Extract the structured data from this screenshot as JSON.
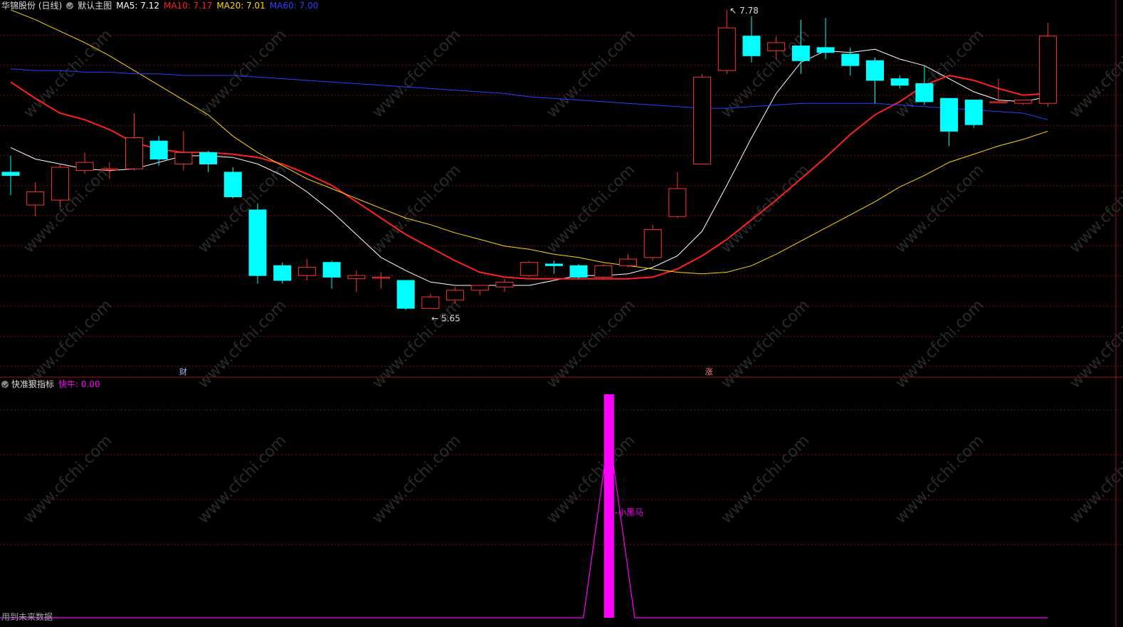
{
  "header": {
    "stock_title": "华锦股份 (日线)",
    "main_chart_label": "默认主图",
    "ma_items": [
      {
        "label": "MA5: 7.12",
        "color": "#ffffff"
      },
      {
        "label": "MA10: 7.17",
        "color": "#ff2020"
      },
      {
        "label": "MA20: 7.01",
        "color": "#ffd700"
      },
      {
        "label": "MA60: 7.00",
        "color": "#2e3dff"
      }
    ]
  },
  "indicator_panel": {
    "title": "快准狠指标",
    "value_label": "快牛: 0.00",
    "value_color": "#ff00ff",
    "signal_label": "小黑马"
  },
  "annotations": {
    "high_label": "7.78",
    "low_label": "5.65",
    "event_cai": "财",
    "event_zhang": "涨"
  },
  "footer": {
    "note": "用到未来数据"
  },
  "watermark": "www.cfchi.com",
  "colors": {
    "up": "#ff3333",
    "down": "#00ffff",
    "grid": "#7a1010"
  },
  "chart_data": {
    "type": "candlestick",
    "price_range": [
      5.55,
      7.85
    ],
    "candles": [
      {
        "o": 6.8,
        "c": 6.78,
        "h": 6.9,
        "l": 6.66
      },
      {
        "o": 6.6,
        "c": 6.68,
        "h": 6.74,
        "l": 6.53
      },
      {
        "o": 6.63,
        "c": 6.83,
        "h": 6.85,
        "l": 6.59
      },
      {
        "o": 6.81,
        "c": 6.86,
        "h": 6.92,
        "l": 6.79
      },
      {
        "o": 6.82,
        "c": 6.82,
        "h": 6.86,
        "l": 6.76
      },
      {
        "o": 6.82,
        "c": 7.01,
        "h": 7.16,
        "l": 6.81
      },
      {
        "o": 6.99,
        "c": 6.88,
        "h": 7.02,
        "l": 6.84
      },
      {
        "o": 6.85,
        "c": 6.92,
        "h": 7.05,
        "l": 6.81
      },
      {
        "o": 6.92,
        "c": 6.85,
        "h": 6.93,
        "l": 6.8
      },
      {
        "o": 6.8,
        "c": 6.65,
        "h": 6.83,
        "l": 6.64
      },
      {
        "o": 6.57,
        "c": 6.17,
        "h": 6.61,
        "l": 6.12
      },
      {
        "o": 6.23,
        "c": 6.14,
        "h": 6.25,
        "l": 6.12
      },
      {
        "o": 6.17,
        "c": 6.22,
        "h": 6.27,
        "l": 6.14
      },
      {
        "o": 6.25,
        "c": 6.16,
        "h": 6.26,
        "l": 6.09
      },
      {
        "o": 6.15,
        "c": 6.17,
        "h": 6.2,
        "l": 6.07
      },
      {
        "o": 6.16,
        "c": 6.16,
        "h": 6.19,
        "l": 6.09
      },
      {
        "o": 6.14,
        "c": 5.97,
        "h": 6.14,
        "l": 5.96
      },
      {
        "o": 5.97,
        "c": 6.04,
        "h": 6.06,
        "l": 5.97
      },
      {
        "o": 6.02,
        "c": 6.08,
        "h": 6.1,
        "l": 6.0
      },
      {
        "o": 6.08,
        "c": 6.11,
        "h": 6.11,
        "l": 6.05
      },
      {
        "o": 6.1,
        "c": 6.13,
        "h": 6.15,
        "l": 6.07
      },
      {
        "o": 6.17,
        "c": 6.25,
        "h": 6.26,
        "l": 6.16
      },
      {
        "o": 6.24,
        "c": 6.23,
        "h": 6.26,
        "l": 6.18
      },
      {
        "o": 6.23,
        "c": 6.16,
        "h": 6.24,
        "l": 6.15
      },
      {
        "o": 6.16,
        "c": 6.23,
        "h": 6.24,
        "l": 6.15
      },
      {
        "o": 6.23,
        "c": 6.27,
        "h": 6.3,
        "l": 6.22
      },
      {
        "o": 6.28,
        "c": 6.45,
        "h": 6.48,
        "l": 6.26
      },
      {
        "o": 6.53,
        "c": 6.7,
        "h": 6.8,
        "l": 6.52
      },
      {
        "o": 6.85,
        "c": 7.38,
        "h": 7.4,
        "l": 6.85
      },
      {
        "o": 7.42,
        "c": 7.68,
        "h": 7.79,
        "l": 7.4
      },
      {
        "o": 7.63,
        "c": 7.51,
        "h": 7.75,
        "l": 7.47
      },
      {
        "o": 7.54,
        "c": 7.59,
        "h": 7.63,
        "l": 7.49
      },
      {
        "o": 7.57,
        "c": 7.48,
        "h": 7.73,
        "l": 7.4
      },
      {
        "o": 7.56,
        "c": 7.53,
        "h": 7.74,
        "l": 7.49
      },
      {
        "o": 7.52,
        "c": 7.45,
        "h": 7.56,
        "l": 7.39
      },
      {
        "o": 7.48,
        "c": 7.36,
        "h": 7.5,
        "l": 7.22
      },
      {
        "o": 7.37,
        "c": 7.33,
        "h": 7.39,
        "l": 7.31
      },
      {
        "o": 7.34,
        "c": 7.23,
        "h": 7.45,
        "l": 7.21
      },
      {
        "o": 7.25,
        "c": 7.05,
        "h": 7.24,
        "l": 6.96
      },
      {
        "o": 7.24,
        "c": 7.09,
        "h": 7.24,
        "l": 7.07
      },
      {
        "o": 7.23,
        "c": 7.23,
        "h": 7.37,
        "l": 7.22
      },
      {
        "o": 7.22,
        "c": 7.24,
        "h": 7.24,
        "l": 7.21
      },
      {
        "o": 7.22,
        "c": 7.63,
        "h": 7.71,
        "l": 7.2
      }
    ],
    "ma_series": [
      {
        "name": "MA5",
        "color": "#ffffff",
        "width": 1,
        "values": [
          6.95,
          6.88,
          6.85,
          6.82,
          6.81,
          6.82,
          6.86,
          6.9,
          6.9,
          6.89,
          6.85,
          6.78,
          6.68,
          6.56,
          6.42,
          6.28,
          6.2,
          6.13,
          6.11,
          6.11,
          6.11,
          6.11,
          6.14,
          6.17,
          6.17,
          6.18,
          6.22,
          6.29,
          6.44,
          6.72,
          7.01,
          7.28,
          7.47,
          7.54,
          7.53,
          7.55,
          7.49,
          7.45,
          7.37,
          7.29,
          7.24,
          7.23,
          7.26
        ]
      },
      {
        "name": "MA10",
        "color": "#ff2020",
        "width": 2,
        "values": [
          7.35,
          7.25,
          7.16,
          7.12,
          7.06,
          6.98,
          6.94,
          6.92,
          6.92,
          6.91,
          6.89,
          6.85,
          6.79,
          6.72,
          6.62,
          6.52,
          6.42,
          6.34,
          6.26,
          6.19,
          6.16,
          6.15,
          6.15,
          6.15,
          6.15,
          6.15,
          6.16,
          6.21,
          6.29,
          6.39,
          6.51,
          6.63,
          6.76,
          6.89,
          7.03,
          7.15,
          7.23,
          7.33,
          7.39,
          7.36,
          7.31,
          7.27,
          7.28
        ]
      },
      {
        "name": "MA20",
        "color": "#ffd700",
        "width": 1,
        "values": [
          7.79,
          7.73,
          7.66,
          7.59,
          7.51,
          7.42,
          7.33,
          7.24,
          7.15,
          7.02,
          6.92,
          6.84,
          6.76,
          6.7,
          6.64,
          6.58,
          6.52,
          6.48,
          6.43,
          6.39,
          6.35,
          6.33,
          6.3,
          6.28,
          6.25,
          6.23,
          6.21,
          6.19,
          6.18,
          6.19,
          6.23,
          6.3,
          6.38,
          6.46,
          6.54,
          6.62,
          6.71,
          6.78,
          6.86,
          6.91,
          6.96,
          7.0,
          7.05
        ]
      },
      {
        "name": "MA60",
        "color": "#2e3dff",
        "width": 1,
        "values": [
          7.43,
          7.42,
          7.42,
          7.41,
          7.41,
          7.4,
          7.4,
          7.39,
          7.39,
          7.39,
          7.38,
          7.37,
          7.36,
          7.35,
          7.34,
          7.33,
          7.32,
          7.31,
          7.3,
          7.29,
          7.28,
          7.26,
          7.25,
          7.24,
          7.23,
          7.22,
          7.21,
          7.2,
          7.19,
          7.19,
          7.2,
          7.21,
          7.22,
          7.22,
          7.22,
          7.22,
          7.21,
          7.2,
          7.19,
          7.18,
          7.17,
          7.16,
          7.12
        ]
      }
    ],
    "indicator": {
      "name": "快牛",
      "values": [
        0,
        0,
        0,
        0,
        0,
        0,
        0,
        0,
        0,
        0,
        0,
        0,
        0,
        0,
        0,
        0,
        0,
        0,
        0,
        0,
        0,
        0,
        0,
        0,
        0,
        0,
        0,
        0,
        0,
        0,
        0,
        0,
        0,
        0,
        0,
        0,
        0,
        0,
        0,
        0,
        0,
        0,
        0
      ],
      "signal_value": 1,
      "range": [
        0,
        1
      ]
    }
  }
}
